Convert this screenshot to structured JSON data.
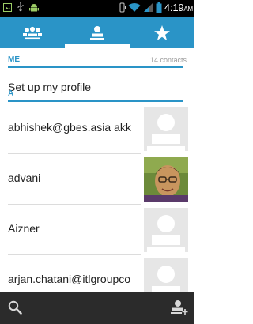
{
  "status_bar": {
    "time": "4:19",
    "ampm": "AM",
    "icons": [
      "image-icon",
      "usb-icon",
      "android-icon",
      "vibrate-icon",
      "wifi-icon",
      "signal-icon",
      "battery-icon"
    ]
  },
  "tabs": [
    {
      "name": "groups",
      "icon": "people-icon",
      "selected": false
    },
    {
      "name": "all-contacts",
      "icon": "person-icon",
      "selected": true
    },
    {
      "name": "favorites",
      "icon": "star-icon",
      "selected": false
    }
  ],
  "me_section": {
    "label": "ME",
    "count": "14 contacts",
    "profile_label": "Set up my profile"
  },
  "letter_section": {
    "label": "A"
  },
  "contacts": [
    {
      "name": "abhishek@gbes.asia akk",
      "avatar": "default"
    },
    {
      "name": "advani",
      "avatar": "photo"
    },
    {
      "name": "Aizner",
      "avatar": "default"
    },
    {
      "name": "arjan.chatani@itlgroupco",
      "avatar": "default"
    }
  ],
  "bottom_bar": {
    "icons": [
      "search-icon",
      "add-contact-icon"
    ]
  },
  "colors": {
    "accent": "#2a94c7",
    "status_bar": "#000000",
    "bottom_bar": "#2b2b2b"
  }
}
